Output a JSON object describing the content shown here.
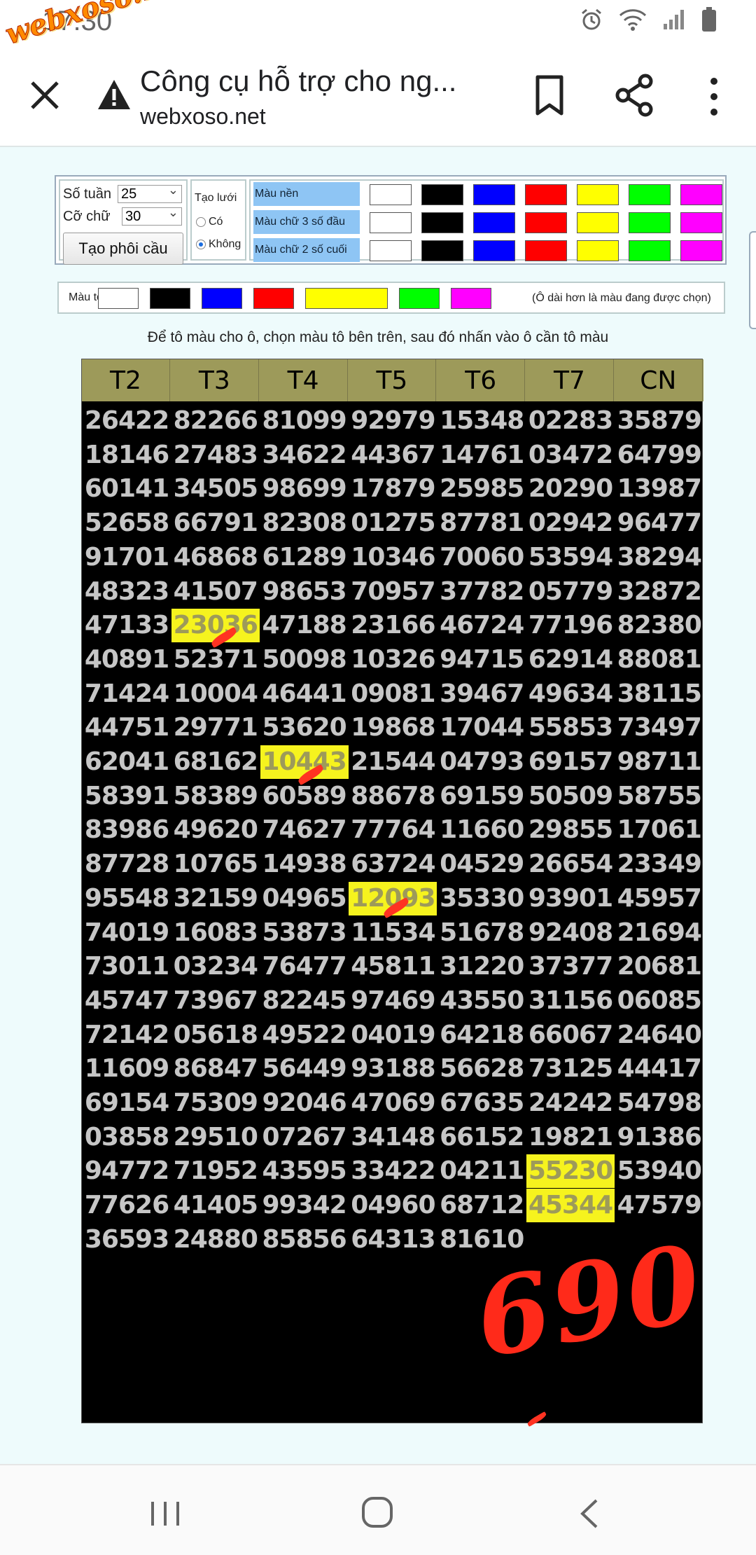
{
  "status_bar": {
    "time": "17:30",
    "watermark": "webxoso.net"
  },
  "toolbar": {
    "title": "Công cụ hỗ trợ cho ng...",
    "url": "webxoso.net"
  },
  "controls": {
    "weeks_label": "Số tuần",
    "weeks_value": "25",
    "font_label": "Cỡ chữ",
    "font_value": "30",
    "create_button": "Tạo phôi cầu",
    "grid_label": "Tạo lưới",
    "grid_yes": "Có",
    "grid_no": "Không",
    "grid_selected": "Không",
    "bg_label": "Màu nền",
    "first3_label": "Màu chữ 3 số đầu",
    "last2_label": "Màu chữ 2 số cuối",
    "palette": [
      "#ffffff",
      "#000000",
      "#0000ff",
      "#ff0000",
      "#ffff00",
      "#00ff00",
      "#ff00ff"
    ]
  },
  "paint": {
    "label": "Màu tô",
    "note": "(Ô dài hơn là màu đang được chọn)",
    "selected_color": "#ffff00"
  },
  "instruction": "Để tô màu cho ô, chọn màu tô bên trên, sau đó nhấn vào ô cần tô màu",
  "board": {
    "headers": [
      "T2",
      "T3",
      "T4",
      "T5",
      "T6",
      "T7",
      "CN"
    ],
    "rows": [
      [
        "26422",
        "82266",
        "81099",
        "92979",
        "15348",
        "02283",
        "35879"
      ],
      [
        "18146",
        "27483",
        "34622",
        "44367",
        "14761",
        "03472",
        "64799"
      ],
      [
        "60141",
        "34505",
        "98699",
        "17879",
        "25985",
        "20290",
        "13987"
      ],
      [
        "52658",
        "66791",
        "82308",
        "01275",
        "87781",
        "02942",
        "96477"
      ],
      [
        "91701",
        "46868",
        "61289",
        "10346",
        "70060",
        "53594",
        "38294"
      ],
      [
        "48323",
        "41507",
        "98653",
        "70957",
        "37782",
        "05779",
        "32872"
      ],
      [
        "47133",
        "23036",
        "47188",
        "23166",
        "46724",
        "77196",
        "82380"
      ],
      [
        "40891",
        "52371",
        "50098",
        "10326",
        "94715",
        "62914",
        "88081"
      ],
      [
        "71424",
        "10004",
        "46441",
        "09081",
        "39467",
        "49634",
        "38115"
      ],
      [
        "44751",
        "29771",
        "53620",
        "19868",
        "17044",
        "55853",
        "73497"
      ],
      [
        "62041",
        "68162",
        "10443",
        "21544",
        "04793",
        "69157",
        "98711"
      ],
      [
        "58391",
        "58389",
        "60589",
        "88678",
        "69159",
        "50509",
        "58755"
      ],
      [
        "83986",
        "49620",
        "74627",
        "77764",
        "11660",
        "29855",
        "17061"
      ],
      [
        "87728",
        "10765",
        "14938",
        "63724",
        "04529",
        "26654",
        "23349"
      ],
      [
        "95548",
        "32159",
        "04965",
        "12093",
        "35330",
        "93901",
        "45957"
      ],
      [
        "74019",
        "16083",
        "53873",
        "11534",
        "51678",
        "92408",
        "21694"
      ],
      [
        "73011",
        "03234",
        "76477",
        "45811",
        "31220",
        "37377",
        "20681"
      ],
      [
        "45747",
        "73967",
        "82245",
        "97469",
        "43550",
        "31156",
        "06085"
      ],
      [
        "72142",
        "05618",
        "49522",
        "04019",
        "64218",
        "66067",
        "24640"
      ],
      [
        "11609",
        "86847",
        "56449",
        "93188",
        "56628",
        "73125",
        "44417"
      ],
      [
        "69154",
        "75309",
        "92046",
        "47069",
        "67635",
        "24242",
        "54798"
      ],
      [
        "03858",
        "29510",
        "07267",
        "34148",
        "66152",
        "19821",
        "91386"
      ],
      [
        "94772",
        "71952",
        "43595",
        "33422",
        "04211",
        "55230",
        "53940"
      ],
      [
        "77626",
        "41405",
        "99342",
        "04960",
        "68712",
        "45344",
        "47579"
      ],
      [
        "36593",
        "24880",
        "85856",
        "64313",
        "81610"
      ]
    ],
    "highlighted": [
      [
        6,
        1
      ],
      [
        10,
        2
      ],
      [
        14,
        3
      ],
      [
        22,
        5
      ],
      [
        23,
        5
      ]
    ],
    "highlight_color": "#f6f31e",
    "handwritten_note": "690"
  }
}
